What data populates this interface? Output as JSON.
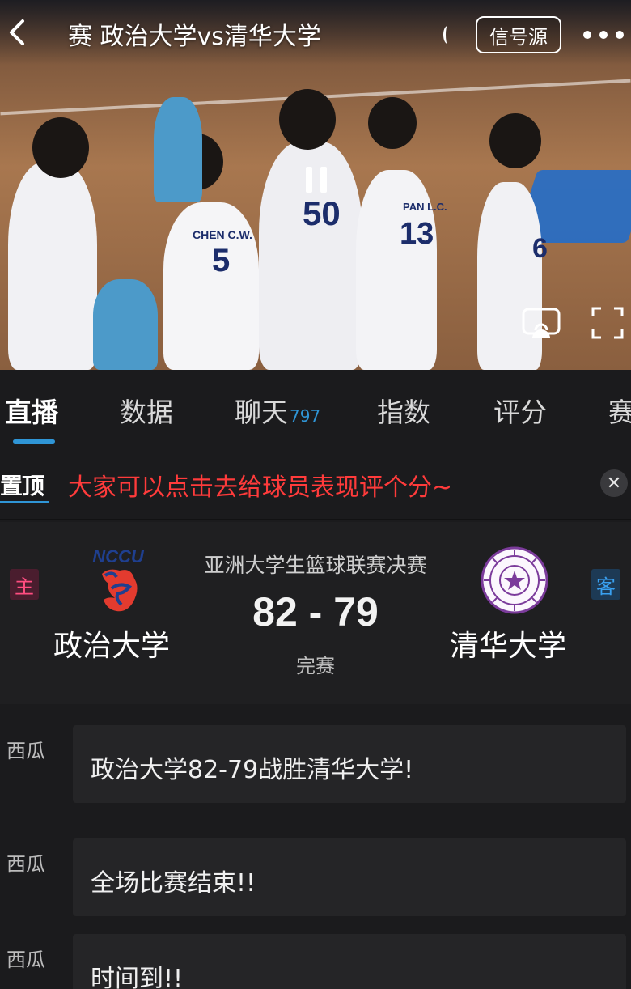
{
  "header": {
    "title": "赛 政治大学vs清华大学",
    "signal_source_label": "信号源"
  },
  "video": {
    "player_numbers": [
      "5",
      "50",
      "13",
      "6"
    ],
    "player_name_labels": [
      "CHEN C.W.",
      "PAN L.C."
    ]
  },
  "tabs": [
    {
      "label": "直播",
      "active": true
    },
    {
      "label": "数据"
    },
    {
      "label": "聊天",
      "badge": "797"
    },
    {
      "label": "指数"
    },
    {
      "label": "评分"
    },
    {
      "label": "赛"
    }
  ],
  "notice": {
    "tag": "置顶",
    "text": "大家可以点击去给球员表现评个分~"
  },
  "match": {
    "league": "亚洲大学生篮球联赛决赛",
    "score": "82 - 79",
    "status": "完赛",
    "home": {
      "tag": "主",
      "name": "政治大学",
      "logo_text": "NCCU"
    },
    "away": {
      "tag": "客",
      "name": "清华大学"
    }
  },
  "feed": [
    {
      "author": "西瓜",
      "text": "政治大学82-79战胜清华大学!"
    },
    {
      "author": "西瓜",
      "text": "全场比赛结束!!"
    },
    {
      "author": "西瓜",
      "text": "时间到!!"
    }
  ],
  "colors": {
    "accent": "#2f95d6",
    "notice_red": "#ff3b3b",
    "home_tag": "#ff4d80",
    "away_tag": "#39a0f0"
  }
}
